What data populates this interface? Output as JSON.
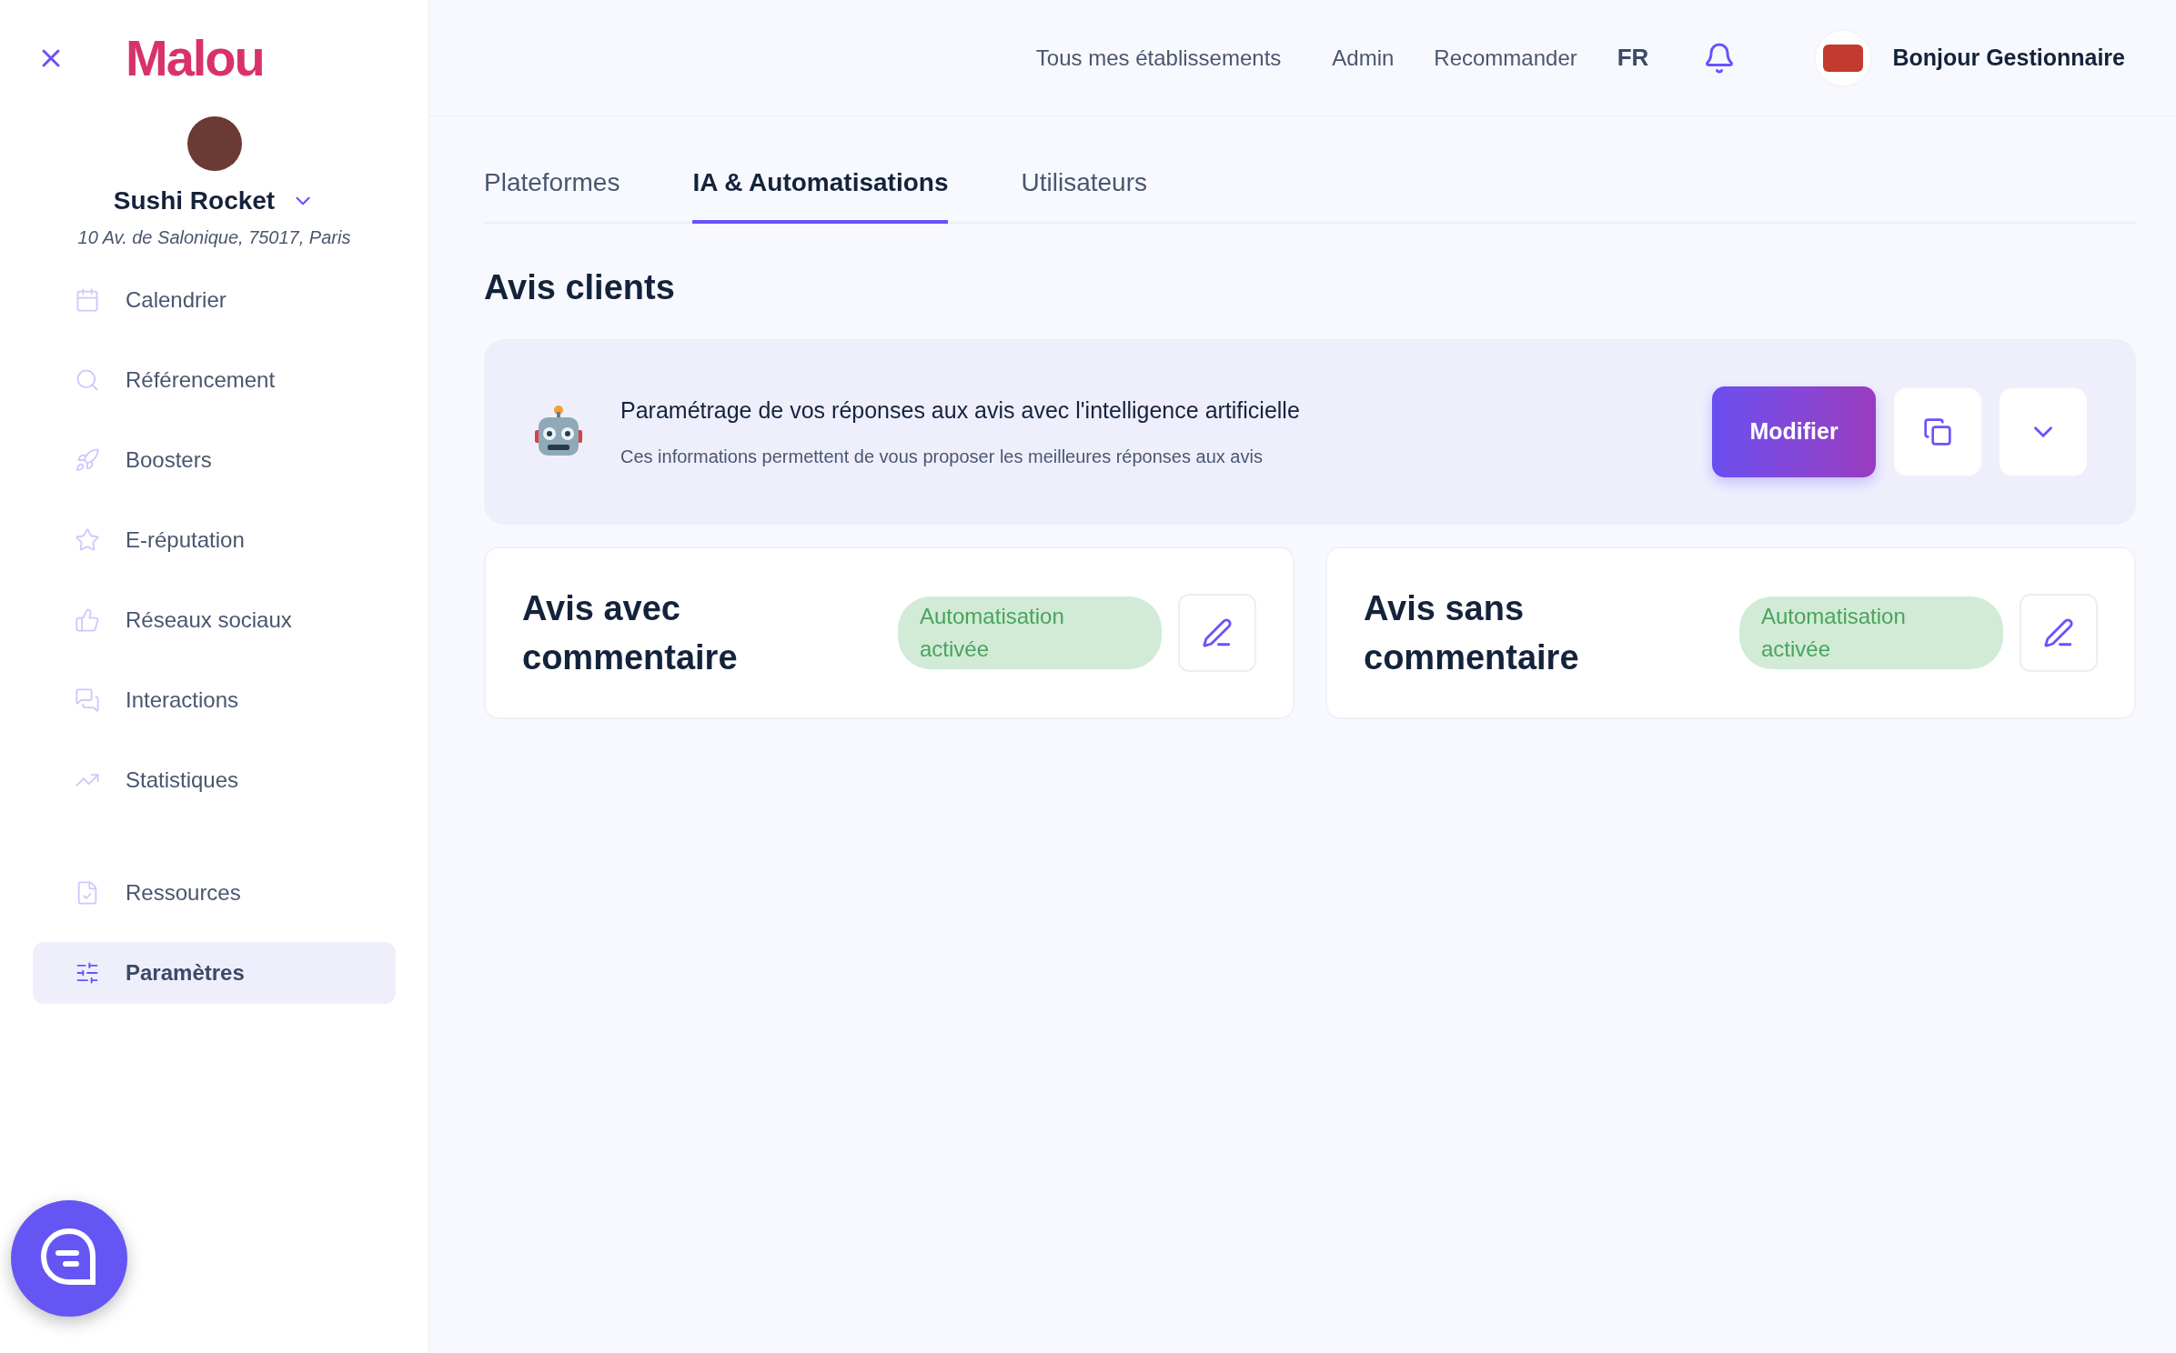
{
  "sidebar": {
    "logo": "Malou",
    "business": {
      "name": "Sushi Rocket",
      "address": "10 Av. de Salonique, 75017, Paris"
    },
    "items": [
      {
        "label": "Calendrier",
        "selected": false
      },
      {
        "label": "Référencement",
        "selected": false
      },
      {
        "label": "Boosters",
        "selected": false
      },
      {
        "label": "E-réputation",
        "selected": false
      },
      {
        "label": "Réseaux sociaux",
        "selected": false
      },
      {
        "label": "Interactions",
        "selected": false
      },
      {
        "label": "Statistiques",
        "selected": false
      }
    ],
    "bottom_items": [
      {
        "label": "Ressources",
        "selected": false
      },
      {
        "label": "Paramètres",
        "selected": true
      }
    ]
  },
  "top_bar": {
    "links": [
      "Tous mes établissements",
      "Admin",
      "Recommander"
    ],
    "language": "FR",
    "greeting": "Bonjour Gestionnaire"
  },
  "tabs": [
    {
      "label": "Plateformes",
      "selected": false
    },
    {
      "label": "IA & Automatisations",
      "selected": true
    },
    {
      "label": "Utilisateurs",
      "selected": false
    }
  ],
  "section_title": "Avis clients",
  "ai_card": {
    "title": "Paramétrage de vos réponses aux avis avec l'intelligence artificielle",
    "description": "Ces informations permettent de vous proposer les meilleures réponses aux avis",
    "button": "Modifier"
  },
  "automations": [
    {
      "title": "Avis avec commentaire",
      "status": "Automatisation activée",
      "active": true
    },
    {
      "title": "Avis sans commentaire",
      "status": "Automatisation activée",
      "active": true
    }
  ]
}
